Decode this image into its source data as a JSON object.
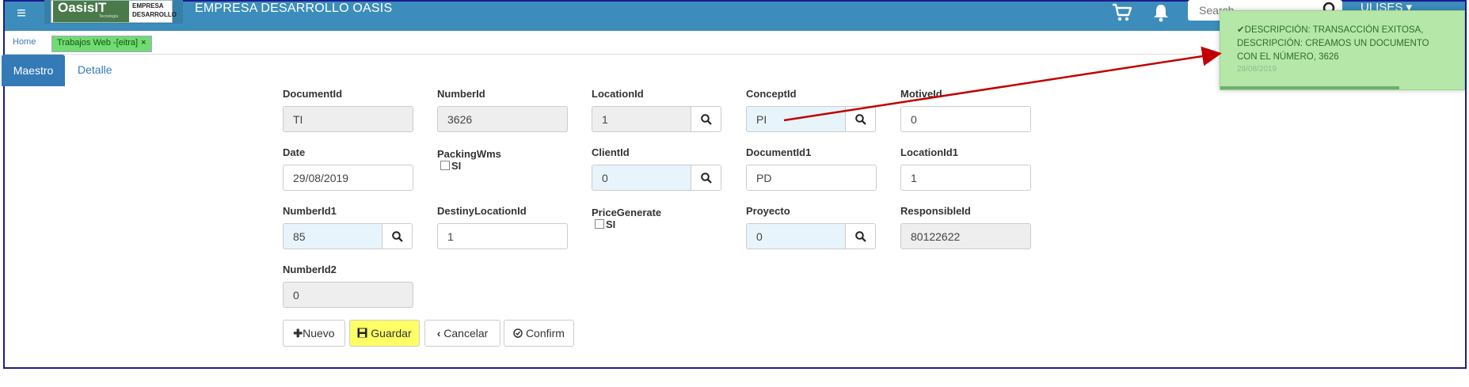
{
  "header": {
    "logo_main": "Oasis",
    "logo_suffix": "IT",
    "logo_sub": "Tecnología",
    "logo_right_line1": "EMPRESA",
    "logo_right_line2": "DESARROLLO",
    "company_title": "EMPRESA DESARROLLO OASIS",
    "search_placeholder": "Search",
    "user_label": "ULISES"
  },
  "tabs": {
    "home": "Home",
    "active": "Trabajos Web -[eitra]",
    "close": "×"
  },
  "section_tabs": {
    "maestro": "Maestro",
    "detalle": "Detalle"
  },
  "form": {
    "document_id": {
      "label": "DocumentId",
      "value": "TI"
    },
    "number_id": {
      "label": "NumberId",
      "value": "3626"
    },
    "location_id": {
      "label": "LocationId",
      "value": "1"
    },
    "concept_id": {
      "label": "ConceptId",
      "value": "PI"
    },
    "motive_id": {
      "label": "MotiveId",
      "value": "0"
    },
    "date": {
      "label": "Date",
      "value": "29/08/2019"
    },
    "packing_wms": {
      "label": "PackingWms",
      "check_label": "SI",
      "checked": false
    },
    "client_id": {
      "label": "ClientId",
      "value": "0"
    },
    "document_id1": {
      "label": "DocumentId1",
      "value": "PD"
    },
    "location_id1": {
      "label": "LocationId1",
      "value": "1"
    },
    "number_id1": {
      "label": "NumberId1",
      "value": "85"
    },
    "destiny_location_id": {
      "label": "DestinyLocationId",
      "value": "1"
    },
    "price_generate": {
      "label": "PriceGenerate",
      "check_label": "SI",
      "checked": false
    },
    "proyecto": {
      "label": "Proyecto",
      "value": "0"
    },
    "responsible_id": {
      "label": "ResponsibleId",
      "value": "80122622"
    },
    "number_id2": {
      "label": "NumberId2",
      "value": "0"
    }
  },
  "buttons": {
    "nuevo": "Nuevo",
    "guardar": "Guardar",
    "cancelar": "Cancelar",
    "confirm": "Confirm"
  },
  "toast": {
    "message": "DESCRIPCIÓN: TRANSACCIÓN EXITOSA, DESCRIPCIÓN: CREAMOS UN DOCUMENTO CON EL NÚMERO, 3626",
    "date": "29/08/2019"
  },
  "colors": {
    "topbar": "#3c8dbc",
    "accent": "#337ab7",
    "toast_bg": "#b5e8a8",
    "highlight": "#ffff66",
    "annotation_arrow": "#c00000"
  }
}
